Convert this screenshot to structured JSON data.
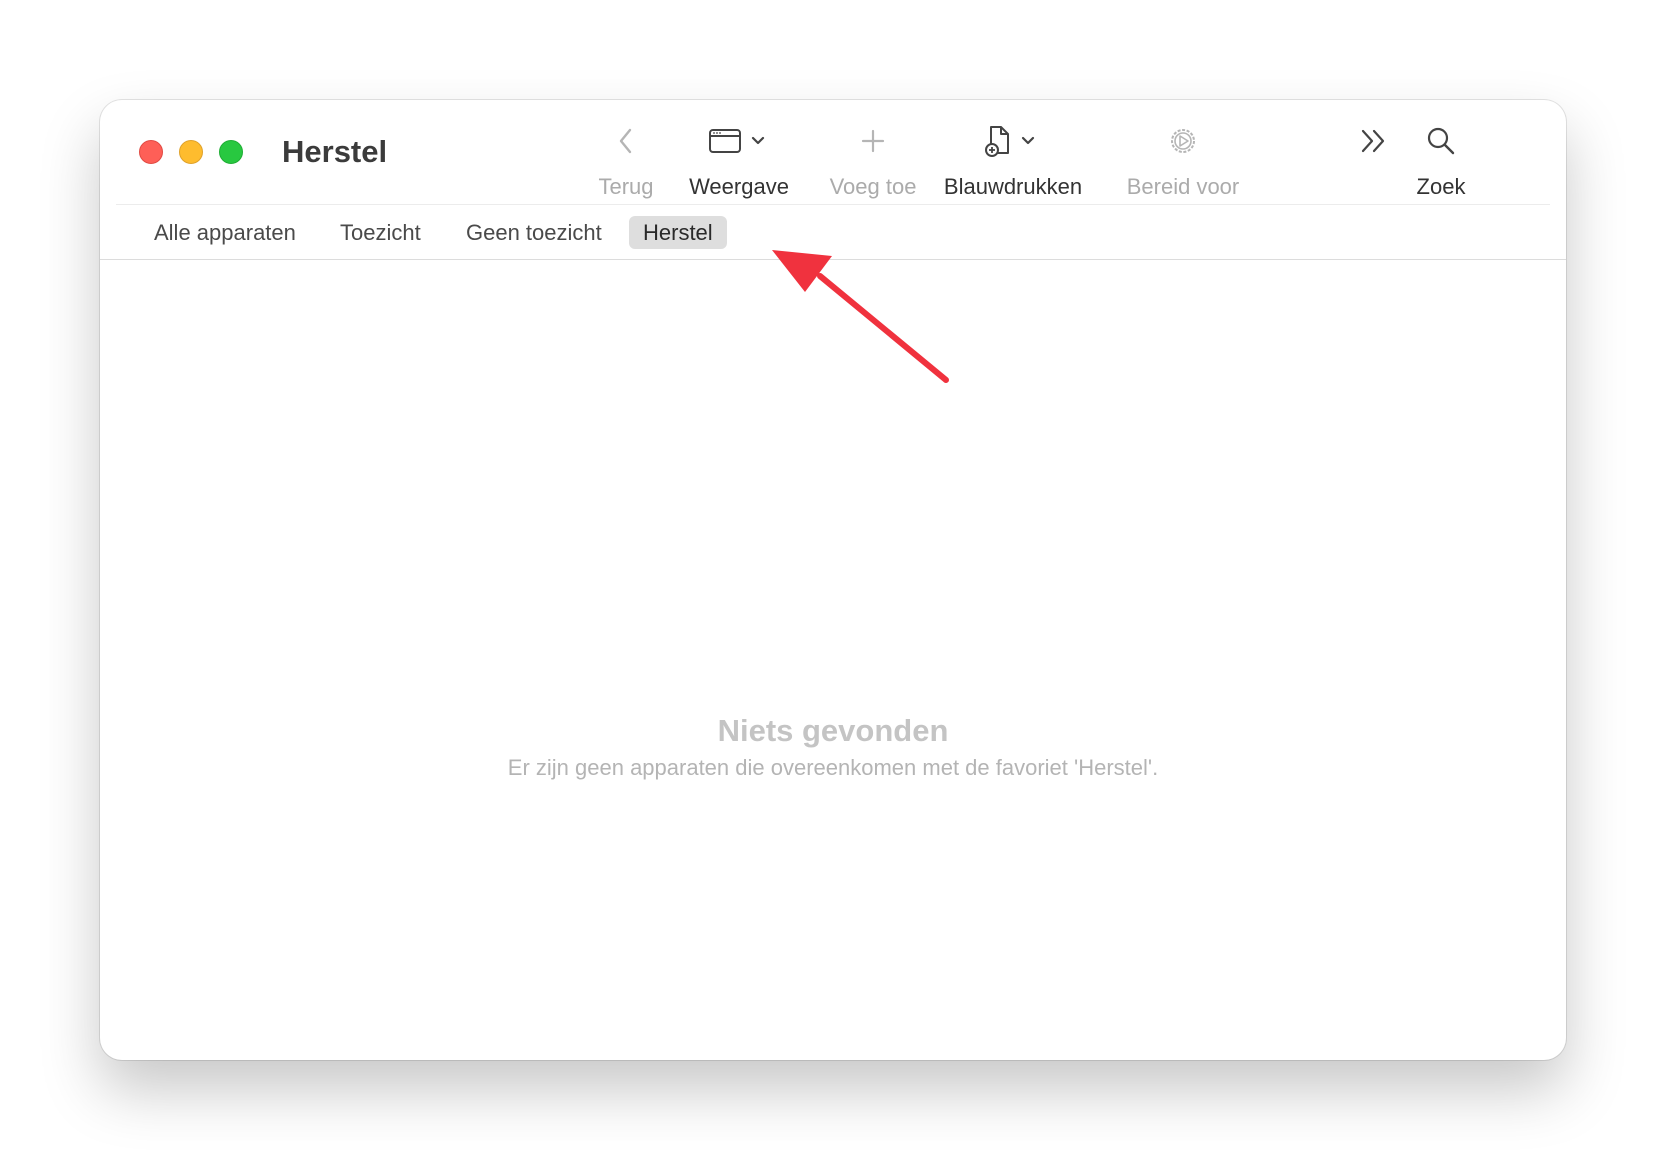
{
  "window": {
    "title": "Herstel"
  },
  "toolbar": {
    "back_label": "Terug",
    "view_label": "Weergave",
    "add_label": "Voeg toe",
    "blueprints_label": "Blauwdrukken",
    "prepare_label": "Bereid voor",
    "search_label": "Zoek"
  },
  "tabs": [
    {
      "label": "Alle apparaten",
      "active": false
    },
    {
      "label": "Toezicht",
      "active": false
    },
    {
      "label": "Geen toezicht",
      "active": false
    },
    {
      "label": "Herstel",
      "active": true
    }
  ],
  "empty_state": {
    "title": "Niets gevonden",
    "message": "Er zijn geen apparaten die overeenkomen met de favoriet 'Herstel'."
  },
  "colors": {
    "close": "#fe5f57",
    "minimize": "#febc2e",
    "maximize": "#28c840",
    "annotation_arrow": "#f0323e"
  }
}
